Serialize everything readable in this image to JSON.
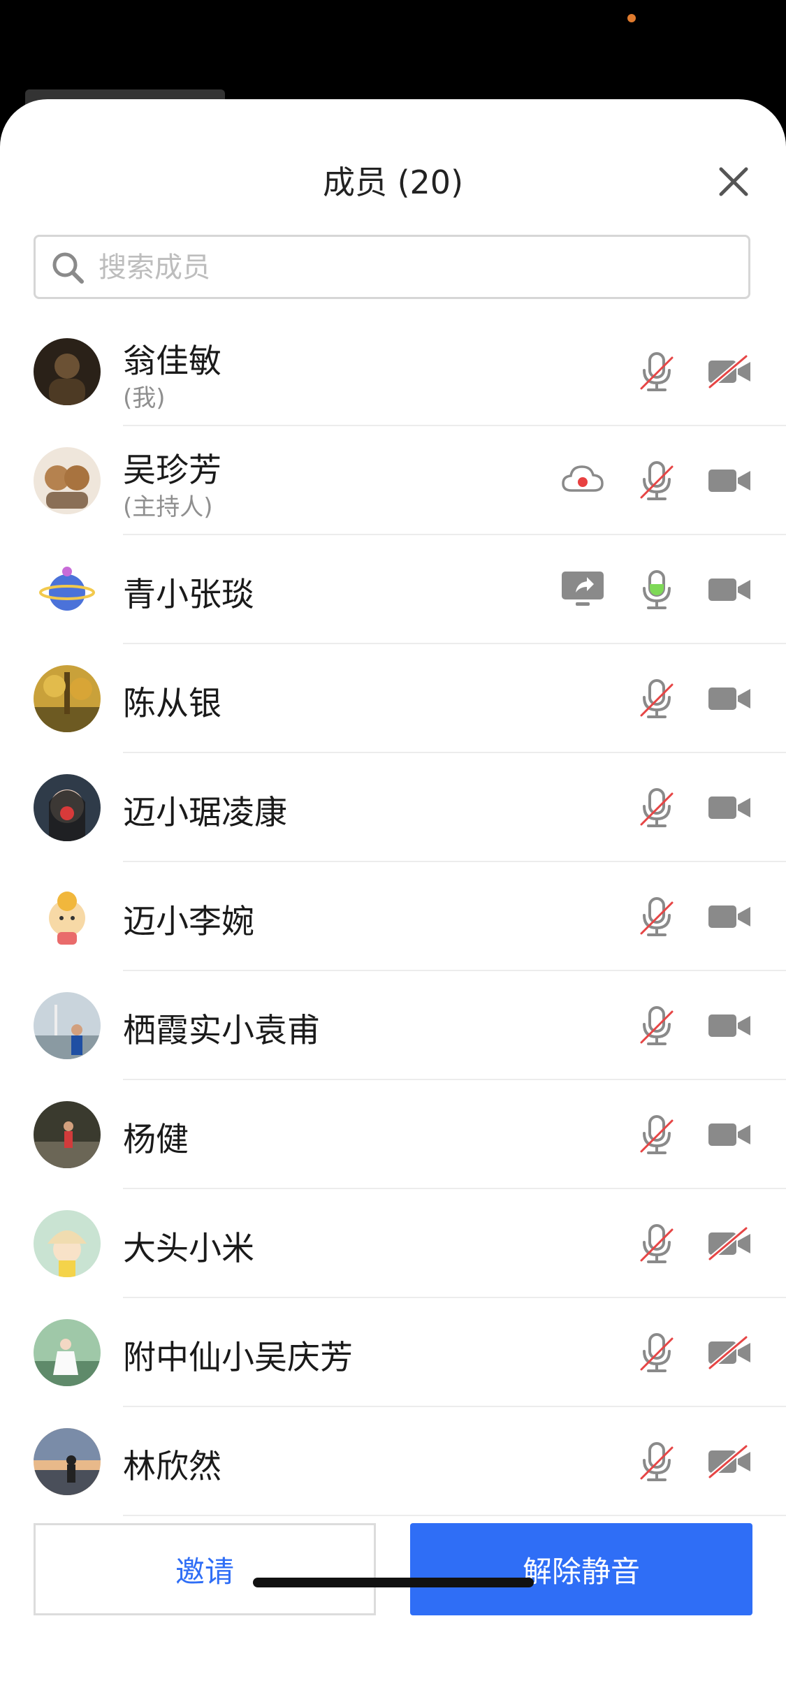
{
  "header": {
    "title": "成员 (20)"
  },
  "search": {
    "placeholder": "搜索成员",
    "value": ""
  },
  "colors": {
    "accent": "#2f6ef6",
    "muted_icon": "#8a8a8a",
    "muted_slash": "#e64545",
    "mic_active": "#7ed957",
    "rec_dot": "#e84040"
  },
  "members": [
    {
      "name": "翁佳敏",
      "sub": "(我)",
      "mic": "muted",
      "camera": "off",
      "extra": null
    },
    {
      "name": "吴珍芳",
      "sub": "(主持人)",
      "mic": "muted",
      "camera": "on",
      "extra": "cloud-record-icon"
    },
    {
      "name": "青小张琰",
      "sub": null,
      "mic": "active",
      "camera": "on",
      "extra": "screen-share-icon"
    },
    {
      "name": "陈从银",
      "sub": null,
      "mic": "muted",
      "camera": "on",
      "extra": null
    },
    {
      "name": "迈小琚凌康",
      "sub": null,
      "mic": "muted",
      "camera": "on",
      "extra": null
    },
    {
      "name": "迈小李婉",
      "sub": null,
      "mic": "muted",
      "camera": "on",
      "extra": null
    },
    {
      "name": "栖霞实小袁甫",
      "sub": null,
      "mic": "muted",
      "camera": "on",
      "extra": null
    },
    {
      "name": "杨健",
      "sub": null,
      "mic": "muted",
      "camera": "on",
      "extra": null
    },
    {
      "name": "大头小米",
      "sub": null,
      "mic": "muted",
      "camera": "off",
      "extra": null
    },
    {
      "name": "附中仙小吴庆芳",
      "sub": null,
      "mic": "muted",
      "camera": "off",
      "extra": null
    },
    {
      "name": "林欣然",
      "sub": null,
      "mic": "muted",
      "camera": "off",
      "extra": null
    }
  ],
  "footer": {
    "invite_label": "邀请",
    "unmute_label": "解除静音"
  }
}
